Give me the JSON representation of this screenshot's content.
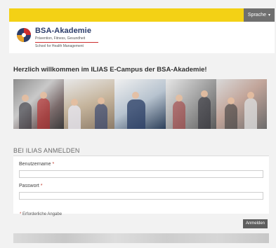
{
  "header": {
    "language_button": "Sprache",
    "language_caret": "▾"
  },
  "logo": {
    "title": "BSA-Akademie",
    "subtitle": "Prävention, Fitness, Gesundheit",
    "tagline": "School for Health Management"
  },
  "welcome_text": "Herzlich willkommen im ILIAS E-Campus der BSA-Akademie!",
  "login": {
    "section_title": "BEI ILIAS ANMELDEN",
    "username_label": "Benutzername",
    "password_label": "Passwort",
    "required_marker": "*",
    "username_value": "",
    "password_value": "",
    "required_note": "Erforderliche Angabe",
    "submit_label": "Anmelden"
  },
  "colors": {
    "accent_yellow": "#f3d115",
    "brand_navy": "#2b3c6a",
    "brand_red": "#cc2d2d"
  }
}
